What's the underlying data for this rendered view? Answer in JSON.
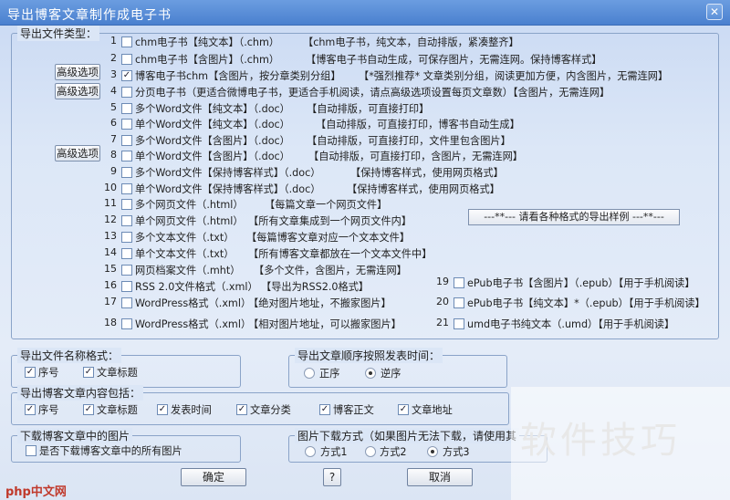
{
  "window": {
    "title": "导出博客文章制作成电子书",
    "close_icon": "close-icon"
  },
  "export_types": {
    "legend": "导出文件类型：",
    "advanced_label": "高级选项",
    "items": [
      {
        "n": "1",
        "checked": false,
        "label": "chm电子书【纯文本】（.chm）",
        "desc": "【chm电子书，纯文本，自动排版，紧凑整齐】"
      },
      {
        "n": "2",
        "checked": false,
        "label": "chm电子书【含图片】（.chm）",
        "desc": "【博客电子书自动生成，可保存图片，无需连网。保持博客样式】"
      },
      {
        "n": "3",
        "checked": true,
        "label": "博客电子书chm【含图片，按分章类别分组】",
        "desc": "【*强烈推荐* 文章类别分组，阅读更加方便，内含图片，无需连网】"
      },
      {
        "n": "4",
        "checked": false,
        "label": "分页电子书（更适合微博电子书，更适合手机阅读，请点高级选项设置每页文章数）【含图片，无需连网】",
        "desc": ""
      },
      {
        "n": "5",
        "checked": false,
        "label": "多个Word文件【纯文本】（.doc）",
        "desc": "【自动排版，可直接打印】"
      },
      {
        "n": "6",
        "checked": false,
        "label": "单个Word文件【纯文本】（.doc）",
        "desc": "【自动排版，可直接打印，博客书自动生成】"
      },
      {
        "n": "7",
        "checked": false,
        "label": "多个Word文件【含图片】（.doc）",
        "desc": "【自动排版，可直接打印，文件里包含图片】"
      },
      {
        "n": "8",
        "checked": false,
        "label": "单个Word文件【含图片】（.doc）",
        "desc": "【自动排版，可直接打印，含图片，无需连网】"
      },
      {
        "n": "9",
        "checked": false,
        "label": "多个Word文件【保持博客样式】（.doc）",
        "desc": "【保持博客样式，使用网页格式】"
      },
      {
        "n": "10",
        "checked": false,
        "label": "单个Word文件【保持博客样式】（.doc）",
        "desc": "【保持博客样式，使用网页格式】"
      },
      {
        "n": "11",
        "checked": false,
        "label": "多个网页文件（.html）",
        "desc": "【每篇文章一个网页文件】"
      },
      {
        "n": "12",
        "checked": false,
        "label": "单个网页文件（.html）",
        "desc": "【所有文章集成到一个网页文件内】"
      },
      {
        "n": "13",
        "checked": false,
        "label": "多个文本文件（.txt）",
        "desc": "【每篇博客文章对应一个文本文件】"
      },
      {
        "n": "14",
        "checked": false,
        "label": "单个文本文件（.txt）",
        "desc": "【所有博客文章都放在一个文本文件中】"
      },
      {
        "n": "15",
        "checked": false,
        "label": "网页档案文件（.mht）",
        "desc": "【多个文件，含图片，无需连网】"
      },
      {
        "n": "16",
        "checked": false,
        "label": "RSS 2.0文件格式（.xml）",
        "desc": "【导出为RSS2.0格式】"
      },
      {
        "n": "17",
        "checked": false,
        "label": "WordPress格式（.xml）",
        "desc": "【绝对图片地址，不搬家图片】"
      },
      {
        "n": "18",
        "checked": false,
        "label": "WordPress格式（.xml）",
        "desc": "【相对图片地址，可以搬家图片】"
      }
    ],
    "side_items": [
      {
        "n": "19",
        "checked": false,
        "label": "ePub电子书【含图片】（.epub）【用于手机阅读】"
      },
      {
        "n": "20",
        "checked": false,
        "label": "ePub电子书【纯文本】*（.epub）【用于手机阅读】"
      },
      {
        "n": "21",
        "checked": false,
        "label": "umd电子书纯文本（.umd）【用于手机阅读】"
      }
    ],
    "sample_button": "---**---  请看各种格式的导出样例  ---**---"
  },
  "filename_format": {
    "legend": "导出文件名称格式：",
    "options": [
      {
        "label": "序号",
        "checked": true
      },
      {
        "label": "文章标题",
        "checked": true
      }
    ]
  },
  "order": {
    "legend": "导出文章顺序按照发表时间：",
    "options": [
      {
        "label": "正序",
        "selected": false
      },
      {
        "label": "逆序",
        "selected": true
      }
    ]
  },
  "content": {
    "legend": "导出博客文章内容包括：",
    "options": [
      {
        "label": "序号",
        "checked": true
      },
      {
        "label": "文章标题",
        "checked": true
      },
      {
        "label": "发表时间",
        "checked": true
      },
      {
        "label": "文章分类",
        "checked": true
      },
      {
        "label": "博客正文",
        "checked": true
      },
      {
        "label": "文章地址",
        "checked": true
      }
    ]
  },
  "images": {
    "legend": "下载博客文章中的图片",
    "checkbox": {
      "label": "是否下载博客文章中的所有图片",
      "checked": false
    }
  },
  "image_method": {
    "legend": "图片下载方式（如果图片无法下载，请使用其",
    "options": [
      {
        "label": "方式1",
        "selected": false
      },
      {
        "label": "方式2",
        "selected": false
      },
      {
        "label": "方式3",
        "selected": true
      }
    ]
  },
  "buttons": {
    "ok": "确定",
    "help": "?",
    "cancel": "取消"
  },
  "watermark": {
    "text": "软件技巧",
    "brand": "php中文网"
  }
}
